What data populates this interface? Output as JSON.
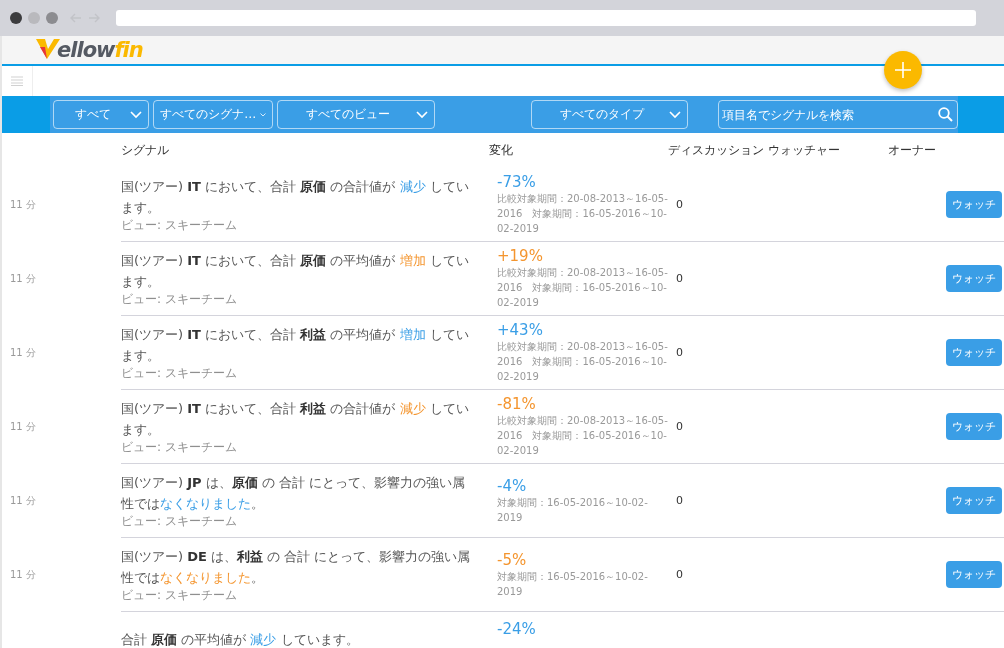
{
  "logo": {
    "text": "ellow",
    "accent": "fin"
  },
  "filters": [
    {
      "label": "すべて"
    },
    {
      "label": "すべてのシグナ…"
    },
    {
      "label": "すべてのビュー"
    },
    {
      "label": "すべてのタイプ"
    }
  ],
  "search": {
    "placeholder": "項目名でシグナルを検索"
  },
  "columns": [
    "シグナル",
    "変化",
    "ディスカッション ウォッチャー",
    "オーナー"
  ],
  "rows": [
    {
      "kind": "full",
      "time": "11 分",
      "text_before": "国(ツアー) **IT** において、合計 **原価** の合計値が ",
      "highlight": "減少",
      "text_after": " しています。",
      "view": "ビュー: スキーチーム",
      "change": "-73%",
      "color": "#3a9ee6",
      "period": "比較対象期間：20-08-2013～16-05-2016　対象期間：16-05-2016～10-02-2019",
      "watchers": "0",
      "button": "ウォッチ"
    },
    {
      "kind": "full",
      "time": "11 分",
      "text_before": "国(ツアー) **IT** において、合計 **原価** の平均値が ",
      "highlight": "増加",
      "text_after": " しています。",
      "view": "ビュー: スキーチーム",
      "change": "+19%",
      "color": "#f4952e",
      "period": "比較対象期間：20-08-2013～16-05-2016　対象期間：16-05-2016～10-02-2019",
      "watchers": "0",
      "button": "ウォッチ"
    },
    {
      "kind": "full",
      "time": "11 分",
      "text_before": "国(ツアー) **IT** において、合計 **利益** の平均値が ",
      "highlight": "増加",
      "text_after": " しています。",
      "view": "ビュー: スキーチーム",
      "change": "+43%",
      "color": "#3a9ee6",
      "period": "比較対象期間：20-08-2013～16-05-2016　対象期間：16-05-2016～10-02-2019",
      "watchers": "0",
      "button": "ウォッチ"
    },
    {
      "kind": "full",
      "time": "11 分",
      "text_before": "国(ツアー) **IT** において、合計 **利益** の合計値が ",
      "highlight": "減少",
      "text_after": " しています。",
      "view": "ビュー: スキーチーム",
      "change": "-81%",
      "color": "#f4952e",
      "period": "比較対象期間：20-08-2013～16-05-2016　対象期間：16-05-2016～10-02-2019",
      "watchers": "0",
      "button": "ウォッチ"
    },
    {
      "kind": "full",
      "time": "11 分",
      "text_before": "国(ツアー) **JP** は、**原価** の 合計 にとって、影響力の強い属性では",
      "highlight": "なくなりました",
      "text_after": "。",
      "view": "ビュー: スキーチーム",
      "change": "-4%",
      "color": "#3a9ee6",
      "period": "対象期間：16-05-2016～10-02-2019",
      "watchers": "0",
      "button": "ウォッチ"
    },
    {
      "kind": "full",
      "time": "11 分",
      "text_before": "国(ツアー) **DE** は、**利益** の 合計 にとって、影響力の強い属性では",
      "highlight": "なくなりました",
      "text_after": "。",
      "view": "ビュー: スキーチーム",
      "change": "-5%",
      "color": "#f4952e",
      "period": "対象期間：16-05-2016～10-02-2019",
      "watchers": "0",
      "button": "ウォッチ"
    },
    {
      "kind": "partial",
      "text": "合計 **原価** の平均値が **減少** しています。",
      "change": "-24%",
      "color": "#3a9ee6"
    }
  ]
}
